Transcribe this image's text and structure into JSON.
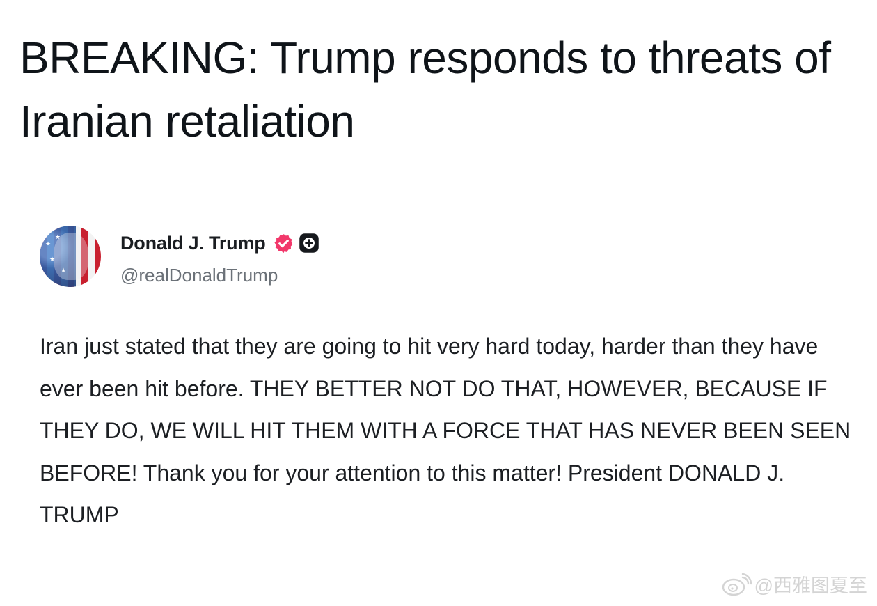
{
  "headline": "BREAKING: Trump responds to threats of Iranian retaliation",
  "post": {
    "author": {
      "display_name": "Donald J. Trump",
      "handle": "@realDonaldTrump",
      "avatar_icon": "flag-portrait-avatar",
      "badges": [
        "verified-badge-icon",
        "plus-badge-icon"
      ],
      "verified_color": "#f2386b"
    },
    "text": "Iran just stated that they are going to hit very hard today, harder than they have ever been hit before. THEY BETTER NOT DO THAT, HOWEVER, BECAUSE IF THEY DO, WE WILL HIT THEM WITH A FORCE THAT HAS NEVER BEEN SEEN BEFORE! Thank you for your attention to this matter! President DONALD J. TRUMP"
  },
  "watermark": {
    "icon": "weibo-icon",
    "text": "@西雅图夏至"
  }
}
